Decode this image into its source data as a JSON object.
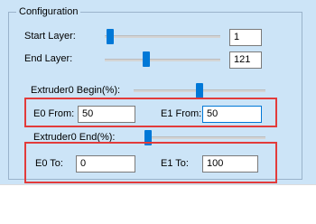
{
  "group": {
    "title": "Configuration"
  },
  "start_layer": {
    "label": "Start Layer:",
    "value": "1",
    "slider_fraction": 0.02
  },
  "end_layer": {
    "label": "End Layer:",
    "value": "121",
    "slider_fraction": 0.35
  },
  "begin": {
    "label": "Extruder0 Begin(%):",
    "slider_fraction": 0.5,
    "e0_label": "E0 From:",
    "e0_value": "50",
    "e1_label": "E1 From:",
    "e1_value": "50"
  },
  "end": {
    "label": "Extruder0 End(%):",
    "slider_fraction": 0.0,
    "e0_label": "E0 To:",
    "e0_value": "0",
    "e1_label": "E1 To:",
    "e1_value": "100"
  },
  "colors": {
    "panel": "#cce4f7",
    "accent": "#0078d7",
    "highlight": "#e23b3b"
  }
}
